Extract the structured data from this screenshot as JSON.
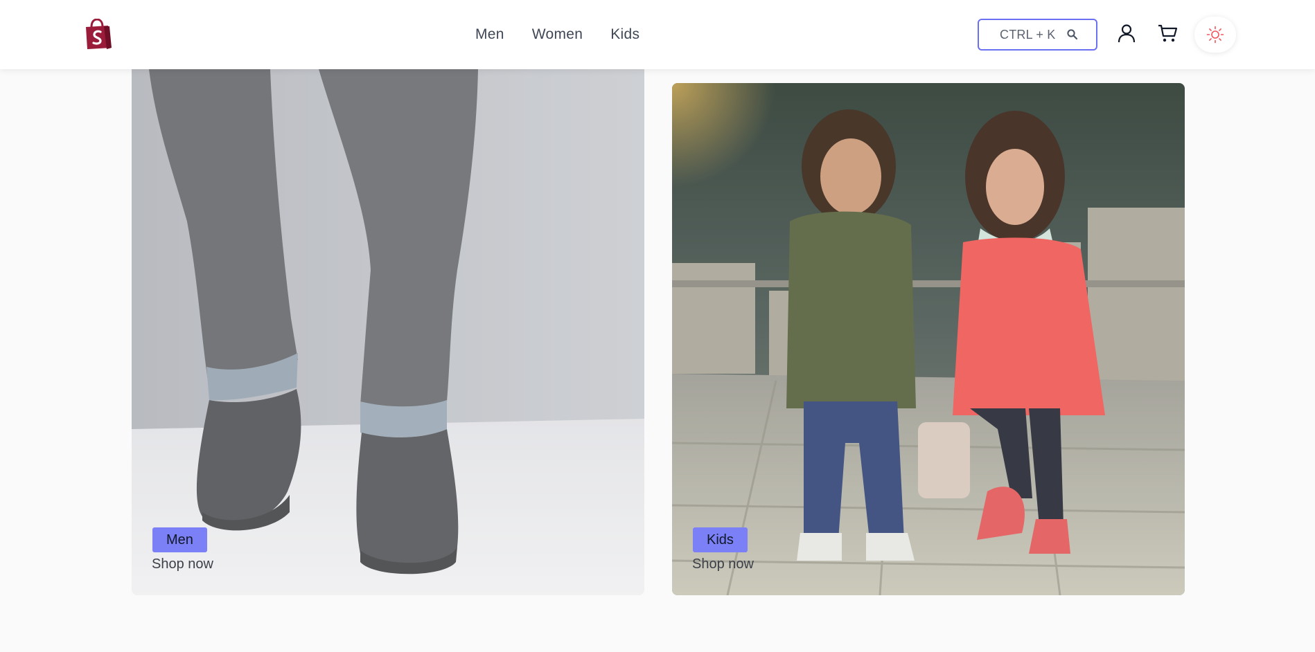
{
  "nav": {
    "items": [
      {
        "label": "Men"
      },
      {
        "label": "Women"
      },
      {
        "label": "Kids"
      }
    ]
  },
  "search": {
    "shortcut_text": "CTRL + K"
  },
  "cards": [
    {
      "label": "Men",
      "cta": "Shop now"
    },
    {
      "label": "Kids",
      "cta": "Shop now"
    }
  ],
  "colors": {
    "brand_logo": "#9b1b3a",
    "accent": "#7b80f6",
    "search_border": "#6b6ff2",
    "theme_icon": "#f2545b"
  },
  "icons": [
    "shopping-bag-logo-icon",
    "search-icon",
    "account-icon",
    "cart-icon",
    "sun-icon"
  ]
}
